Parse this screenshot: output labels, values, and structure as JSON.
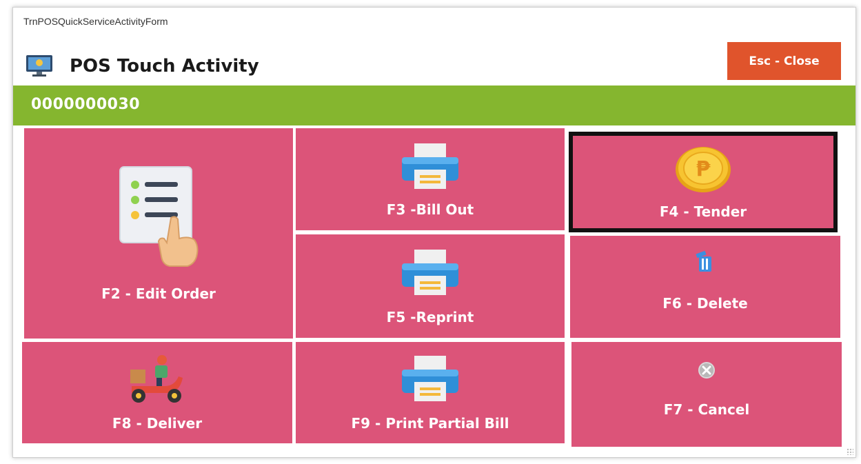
{
  "window": {
    "form_name": "TrnPOSQuickServiceActivityForm",
    "title": "POS Touch Activity",
    "title_icon": "monitor-icon",
    "close_label": "Esc - Close"
  },
  "header": {
    "number": "0000000030"
  },
  "tiles": {
    "edit_order": {
      "label": "F2 - Edit Order",
      "icon": "order-list-hand-icon"
    },
    "bill_out": {
      "label": "F3 -Bill Out",
      "icon": "printer-icon"
    },
    "tender": {
      "label": "F4 - Tender",
      "icon": "peso-coin-icon"
    },
    "reprint": {
      "label": "F5 -Reprint",
      "icon": "printer-icon"
    },
    "delete": {
      "label": "F6 - Delete",
      "icon": "trash-icon"
    },
    "deliver": {
      "label": "F8 - Deliver",
      "icon": "delivery-scooter-icon"
    },
    "print_partial": {
      "label": "F9 - Print Partial Bill",
      "icon": "printer-icon"
    },
    "cancel": {
      "label": "F7 - Cancel",
      "icon": "cancel-icon"
    }
  },
  "colors": {
    "tile": "#dc5479",
    "header_bar": "#85b62f",
    "close_button": "#e0542c",
    "selected_border": "#111111"
  }
}
